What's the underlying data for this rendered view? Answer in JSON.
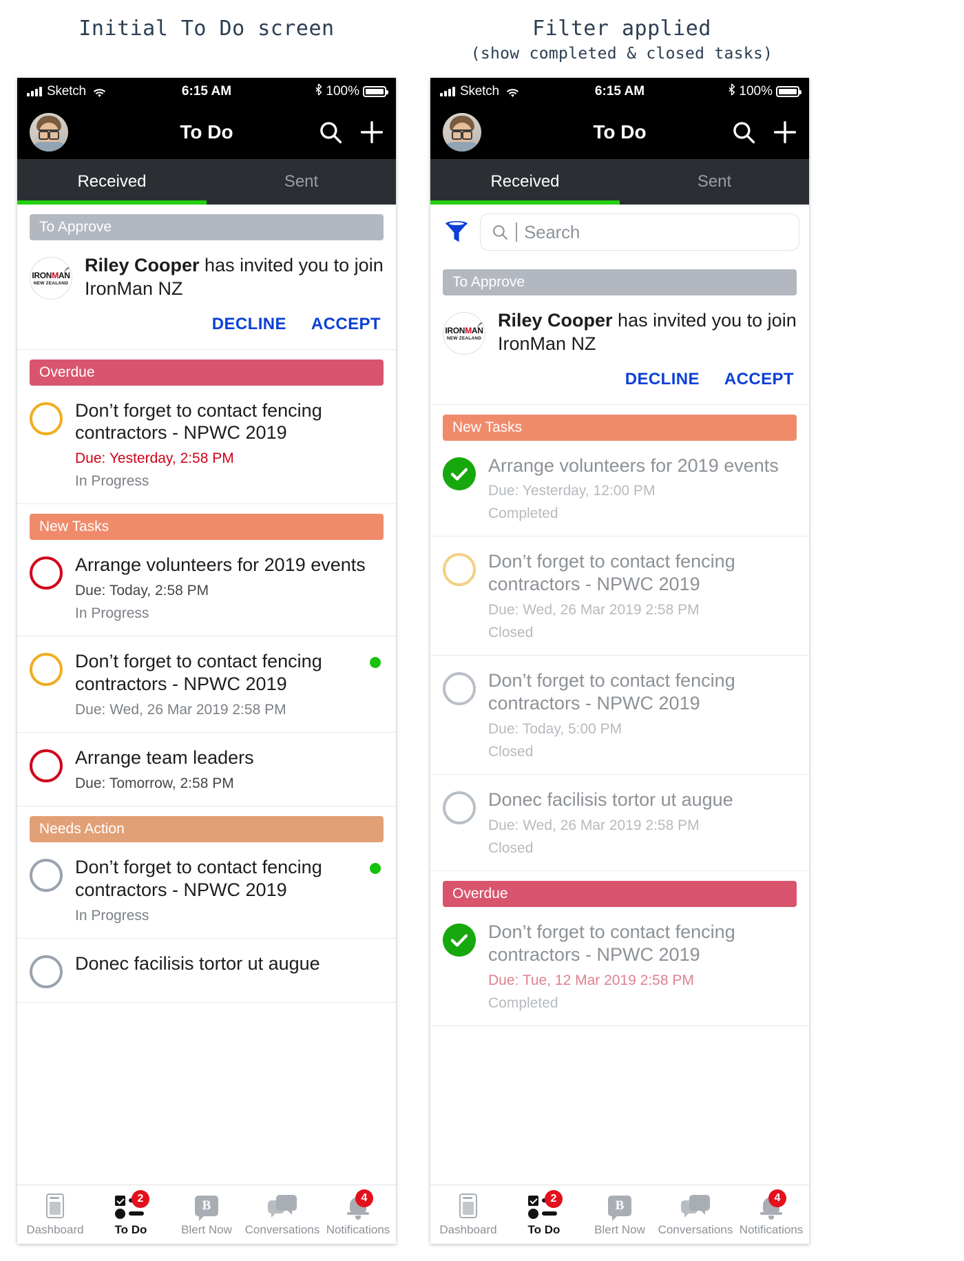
{
  "captions": {
    "left": {
      "line1": "Initial To Do screen",
      "line2": ""
    },
    "right": {
      "line1": "Filter applied",
      "line2": "(show completed & closed tasks)"
    }
  },
  "status_bar": {
    "carrier": "Sketch",
    "time": "6:15 AM",
    "battery": "100%",
    "wifi_icon": "wifi-icon",
    "bluetooth_icon": "bluetooth-icon",
    "signal_icon": "signal-bars-icon"
  },
  "nav": {
    "title": "To Do",
    "search_icon": "search-icon",
    "add_icon": "plus-icon",
    "avatar": "user-avatar"
  },
  "tabs": [
    {
      "label": "Received",
      "active": true
    },
    {
      "label": "Sent",
      "active": false
    }
  ],
  "search": {
    "placeholder": "Search",
    "value": "",
    "filter_icon": "filter-funnel-icon",
    "search_icon": "search-icon"
  },
  "org": {
    "logo_name": "ironman-new-zealand-logo",
    "logo_top": "IRONMAN",
    "logo_bottom": "NEW ZEALAND"
  },
  "invite": {
    "person": "Riley Cooper",
    "text_rest": " has invited you to join IronMan NZ",
    "full_text": "Riley Cooper has invited you to join IronMan NZ",
    "decline_label": "DECLINE",
    "accept_label": "ACCEPT"
  },
  "colors": {
    "to_approve": "#b3b8c0",
    "overdue": "#d9556e",
    "new_tasks": "#ef8b6b",
    "needs_action": "#e2a077",
    "accent_green": "#21d10d",
    "link_blue": "#0b3fd6",
    "badge_red": "#e4101d",
    "done_green": "#16a80d",
    "circle_red": "#d0021b",
    "circle_amber": "#f0ad20",
    "circle_grey": "#9aa3ae"
  },
  "left_panel": {
    "sections": [
      {
        "header": "To Approve",
        "header_style": "sh-approve",
        "type": "invite"
      },
      {
        "header": "Overdue",
        "header_style": "sh-overdue",
        "type": "tasks",
        "tasks": [
          {
            "title": "Don’t forget to contact fencing contractors - NPWC 2019",
            "due": "Due: Yesterday, 2:58 PM",
            "due_style": "red",
            "status": "In Progress",
            "circle": "amber",
            "green_dot": false
          }
        ]
      },
      {
        "header": "New Tasks",
        "header_style": "sh-new",
        "type": "tasks",
        "tasks": [
          {
            "title": "Arrange volunteers for 2019 events",
            "due": "Due: Today, 2:58 PM",
            "due_style": "",
            "status": "In Progress",
            "circle": "red",
            "green_dot": false
          },
          {
            "title": "Don’t forget to contact fencing contractors - NPWC 2019",
            "due": "Due: Wed, 26 Mar 2019 2:58 PM",
            "due_style": "grey",
            "status": "",
            "circle": "amber",
            "green_dot": true
          },
          {
            "title": "Arrange team leaders",
            "due": "Due: Tomorrow, 2:58 PM",
            "due_style": "",
            "status": "",
            "circle": "red",
            "green_dot": false
          }
        ]
      },
      {
        "header": "Needs Action",
        "header_style": "sh-needs",
        "type": "tasks",
        "tasks": [
          {
            "title": "Don’t forget to contact fencing contractors - NPWC 2019",
            "due": "",
            "due_style": "",
            "status": "In Progress",
            "circle": "grey",
            "green_dot": true
          },
          {
            "title": "Donec facilisis tortor ut augue",
            "due": "",
            "due_style": "",
            "status": "",
            "circle": "grey",
            "green_dot": false
          }
        ]
      }
    ]
  },
  "right_panel": {
    "sections": [
      {
        "header": "To Approve",
        "header_style": "sh-approve",
        "type": "invite"
      },
      {
        "header": "New Tasks",
        "header_style": "sh-new",
        "type": "tasks",
        "tasks": [
          {
            "title": "Arrange volunteers for 2019 events",
            "due": "Due: Yesterday, 12:00 PM",
            "due_style": "vgrey",
            "status": "Completed",
            "circle": "done",
            "muted": true,
            "green_dot": false
          },
          {
            "title": "Don’t forget to contact fencing contractors - NPWC 2019",
            "due": "Due: Wed, 26 Mar 2019 2:58 PM",
            "due_style": "vgrey",
            "status": "Closed",
            "circle": "amberl",
            "muted": true,
            "green_dot": false
          },
          {
            "title": "Don’t forget to contact fencing contractors - NPWC 2019",
            "due": "Due: Today, 5:00 PM",
            "due_style": "vgrey",
            "status": "Closed",
            "circle": "greyl",
            "muted": true,
            "green_dot": false
          },
          {
            "title": "Donec facilisis tortor ut augue",
            "due": "Due: Wed, 26 Mar 2019 2:58 PM",
            "due_style": "vgrey",
            "status": "Closed",
            "circle": "greyl",
            "muted": true,
            "green_dot": false
          }
        ]
      },
      {
        "header": "Overdue",
        "header_style": "sh-overdue",
        "type": "tasks",
        "tasks": [
          {
            "title": "Don’t forget to contact fencing contractors - NPWC 2019",
            "due": "Due: Tue, 12 Mar 2019 2:58 PM",
            "due_style": "mutedred",
            "status": "Completed",
            "circle": "done",
            "muted": true,
            "green_dot": false
          }
        ]
      }
    ]
  },
  "tabbar": [
    {
      "label": "Dashboard",
      "icon": "dashboard-icon",
      "badge": "",
      "active": false
    },
    {
      "label": "To Do",
      "icon": "todo-list-icon",
      "badge": "2",
      "active": true
    },
    {
      "label": "Blert Now",
      "icon": "blert-icon",
      "badge": "",
      "active": false
    },
    {
      "label": "Conversations",
      "icon": "conversations-icon",
      "badge": "",
      "active": false
    },
    {
      "label": "Notifications",
      "icon": "bell-icon",
      "badge": "4",
      "active": false
    }
  ]
}
